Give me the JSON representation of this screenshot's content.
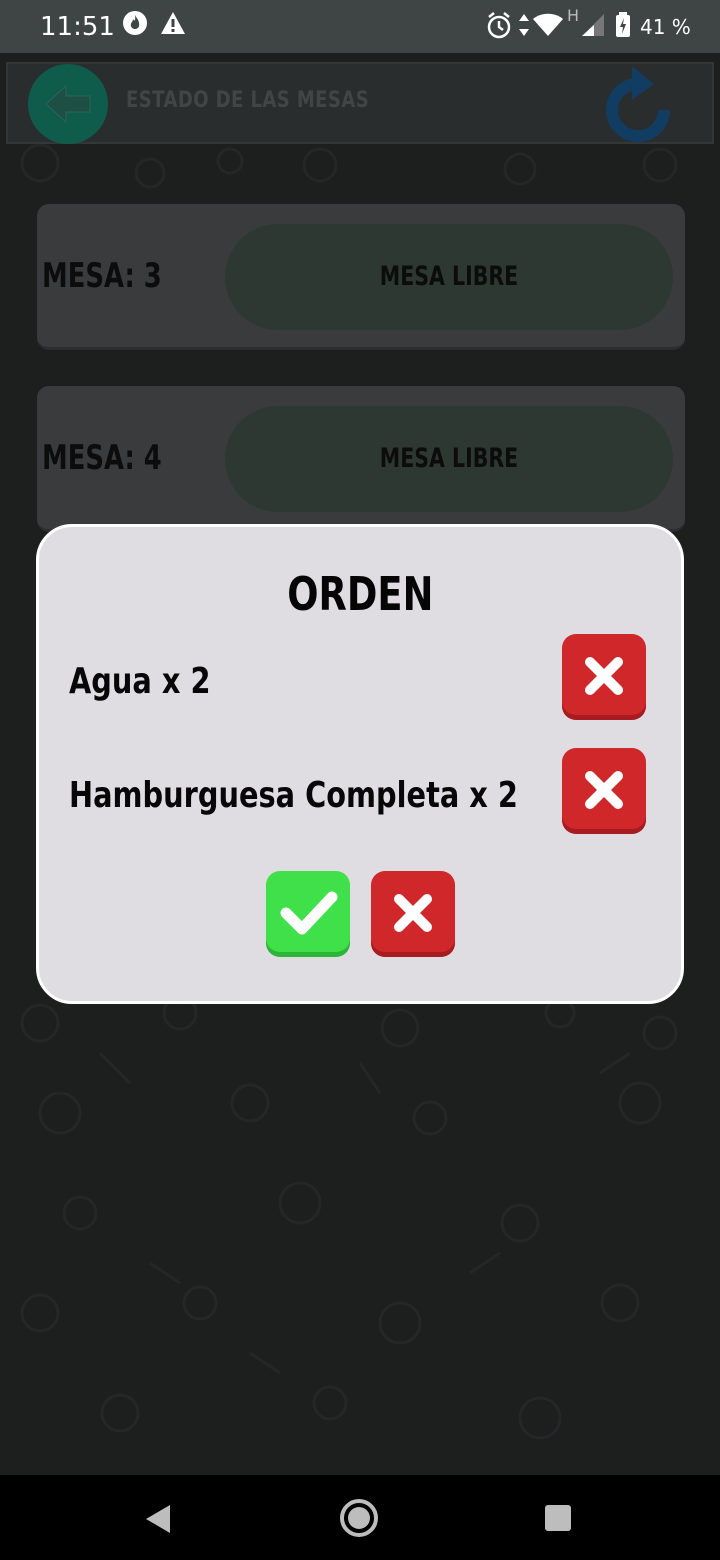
{
  "status_bar": {
    "time": "11:51",
    "battery_percent": "41 %",
    "network_label": "H",
    "icons": [
      "flame-app-icon",
      "warning-icon",
      "alarm-icon",
      "data-arrows-icon",
      "wifi-icon",
      "signal-icon",
      "battery-icon"
    ]
  },
  "toolbar": {
    "title": "ESTADO DE LAS MESAS",
    "back_icon": "arrow-left-icon",
    "refresh_icon": "refresh-icon",
    "colors": {
      "back": "#0f5c4c",
      "refresh": "#1a4a7a"
    }
  },
  "mesas": [
    {
      "label": "MESA: 3",
      "status": "MESA LIBRE"
    },
    {
      "label": "MESA: 4",
      "status": "MESA LIBRE"
    }
  ],
  "dialog": {
    "title": "ORDEN",
    "items": [
      {
        "text": "Agua x 2",
        "remove_icon": "close-icon"
      },
      {
        "text": "Hamburguesa Completa x 2",
        "remove_icon": "close-icon"
      }
    ],
    "confirm_icon": "check-icon",
    "cancel_icon": "close-icon",
    "colors": {
      "confirm": "#3fe04a",
      "cancel": "#d0272b"
    }
  },
  "nav_bar": {
    "icons": [
      "back-triangle-icon",
      "home-circle-icon",
      "recents-square-icon"
    ]
  }
}
